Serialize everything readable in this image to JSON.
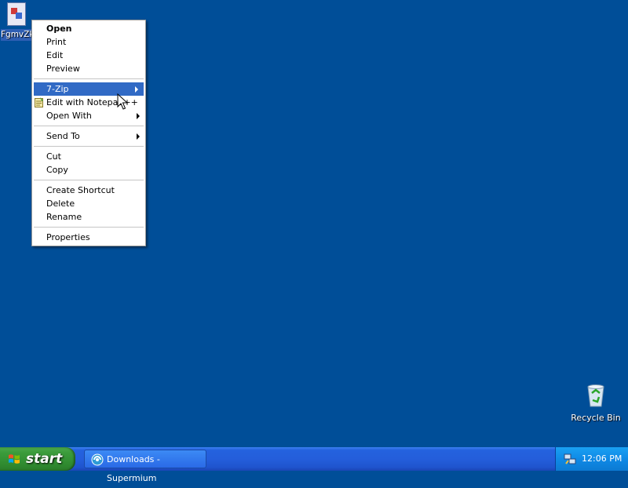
{
  "desktop": {
    "file_icon_label": "FgmvZk RX",
    "recycle_bin_label": "Recycle Bin"
  },
  "context_menu": {
    "open": "Open",
    "print": "Print",
    "edit": "Edit",
    "preview": "Preview",
    "zip": "7-Zip",
    "edit_notepad": "Edit with Notepad++",
    "open_with": "Open With",
    "send_to": "Send To",
    "cut": "Cut",
    "copy": "Copy",
    "create_shortcut": "Create Shortcut",
    "delete": "Delete",
    "rename": "Rename",
    "properties": "Properties"
  },
  "taskbar": {
    "start_label": "start",
    "task_label": "Downloads - Supermium",
    "clock": "12:06 PM"
  },
  "colors": {
    "desktop": "#004e98",
    "highlight": "#316ac5",
    "taskbar": "#245edb",
    "start": "#3b9b3b"
  }
}
